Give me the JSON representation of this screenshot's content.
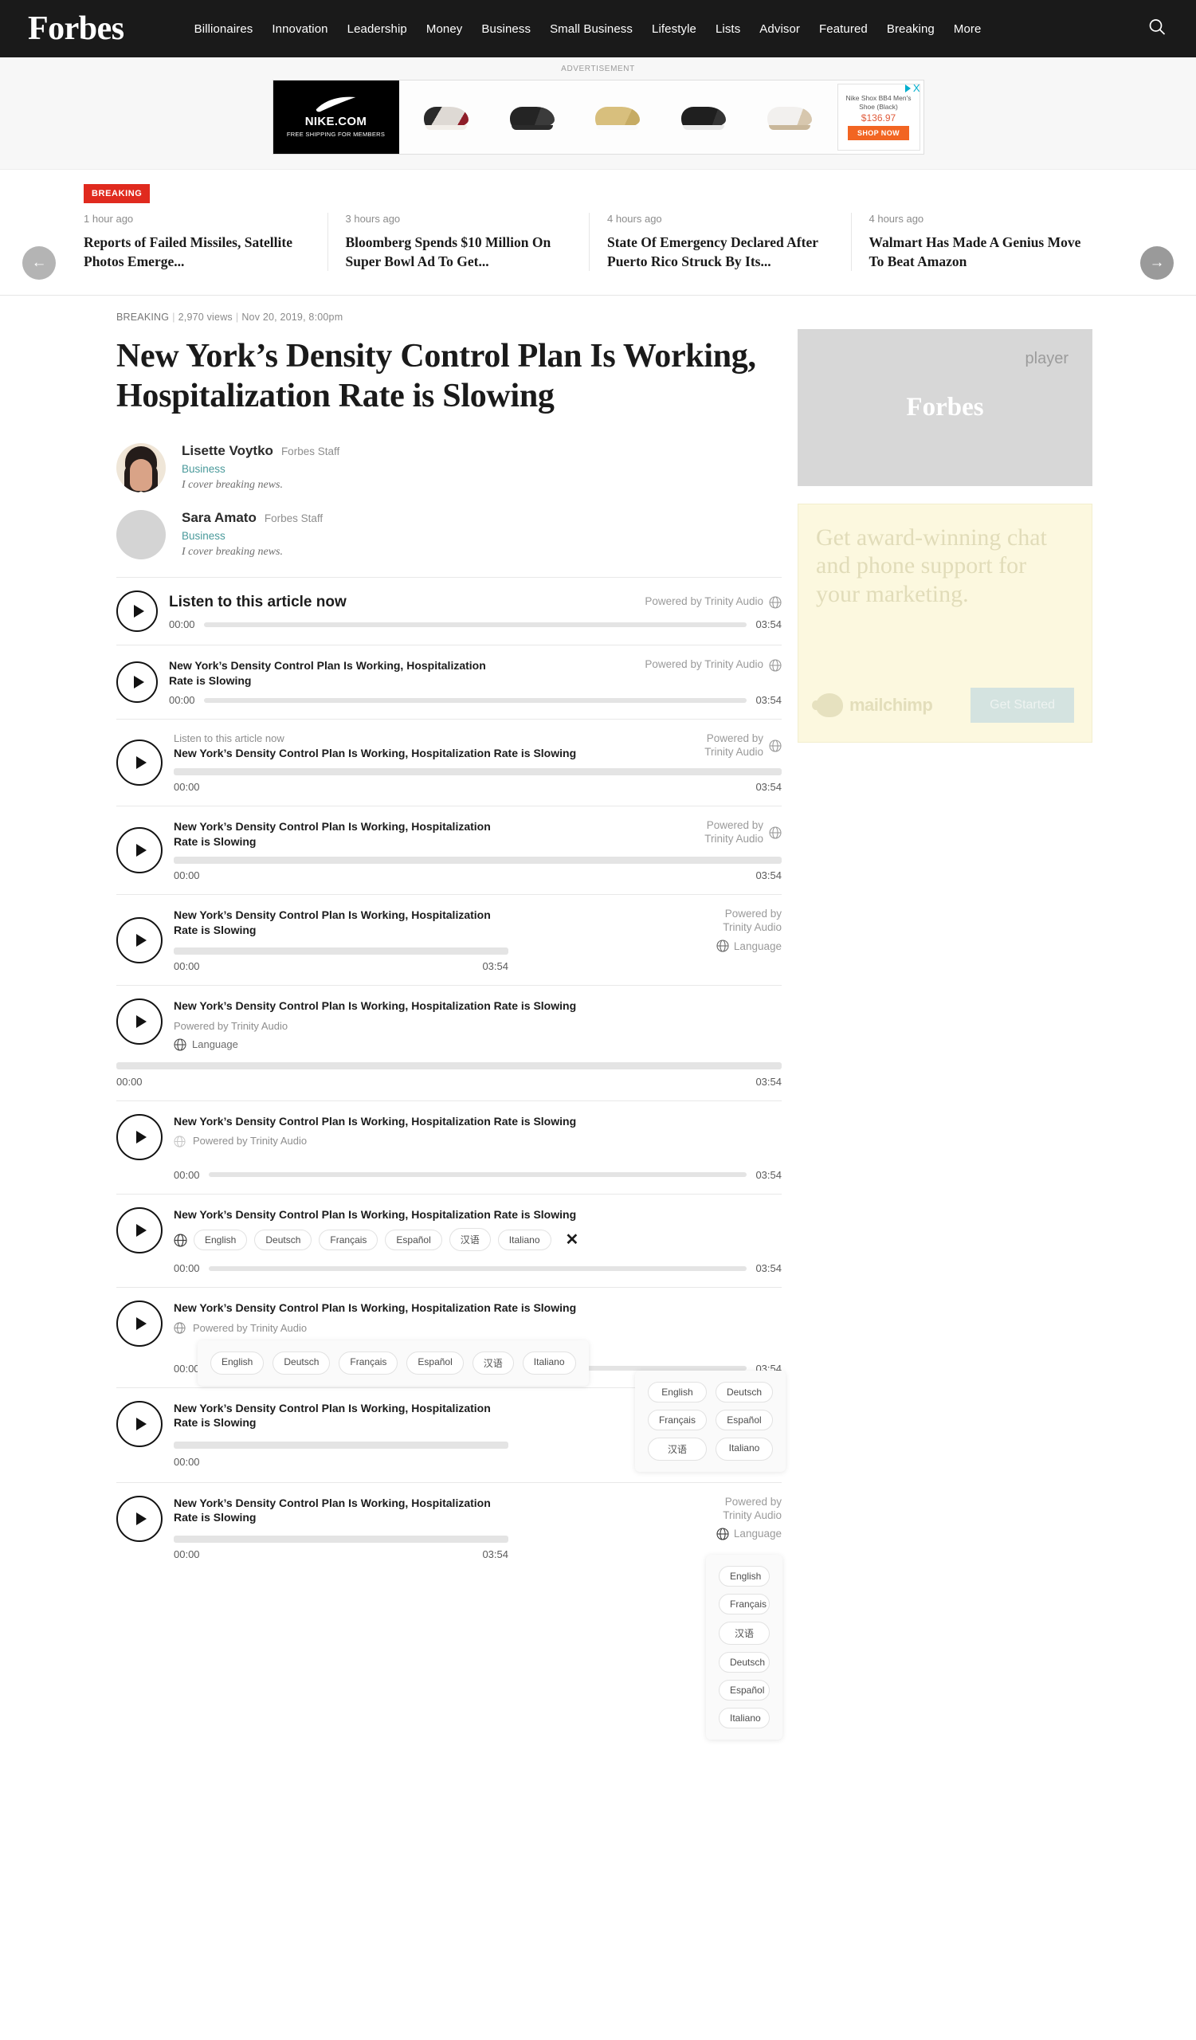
{
  "nav": {
    "logo": "Forbes",
    "items": [
      "Billionaires",
      "Innovation",
      "Leadership",
      "Money",
      "Business",
      "Small Business",
      "Lifestyle",
      "Lists",
      "Advisor",
      "Featured",
      "Breaking",
      "More"
    ],
    "search_icon": "search-icon"
  },
  "ad": {
    "label": "ADVERTISEMENT",
    "brand_url": "NIKE.COM",
    "brand_sub": "FREE SHIPPING FOR MEMBERS",
    "product_name": "Nike Shox BB4 Men's Shoe (Black)",
    "price": "$136.97",
    "cta": "SHOP NOW",
    "close": "X"
  },
  "breaking": {
    "badge": "BREAKING",
    "prev_arrow": "←",
    "next_arrow": "→",
    "items": [
      {
        "time": "1 hour ago",
        "title": "Reports of Failed Missiles, Satellite Photos Emerge..."
      },
      {
        "time": "3 hours ago",
        "title": "Bloomberg Spends $10 Million On Super Bowl Ad To Get..."
      },
      {
        "time": "4 hours ago",
        "title": "State Of Emergency Declared After Puerto Rico Struck By Its..."
      },
      {
        "time": "4 hours ago",
        "title": "Walmart Has Made A Genius Move To Beat Amazon"
      }
    ]
  },
  "article": {
    "category": "BREAKING",
    "views": "2,970 views",
    "date": "Nov 20, 2019, 8:00pm",
    "headline": "New York’s Density Control Plan Is Working, Hospitalization Rate is Slowing",
    "authors": [
      {
        "name": "Lisette Voytko",
        "role": "Forbes Staff",
        "category": "Business",
        "bio": "I cover breaking news."
      },
      {
        "name": "Sara Amato",
        "role": "Forbes Staff",
        "category": "Business",
        "bio": "I cover breaking news."
      }
    ]
  },
  "player": {
    "listen_label": "Listen to this article now",
    "title": "New York’s Density Control Plan Is Working, Hospitalization Rate is Slowing",
    "powered_by": "Powered by Trinity Audio",
    "powered_by_line1": "Powered by",
    "powered_by_line2": "Trinity Audio",
    "current_time": "00:00",
    "duration": "03:54",
    "language_label": "Language",
    "close_label": "✕",
    "globe_icon": "globe-icon",
    "play_icon": "play-icon",
    "languages": [
      "English",
      "Deutsch",
      "Français",
      "Español",
      "汉语",
      "Italiano"
    ],
    "languages_vertical": [
      "English",
      "Français",
      "汉语",
      "Deutsch",
      "Español",
      "Italiano"
    ]
  },
  "sidebar": {
    "player_badge": "player",
    "player_logo": "Forbes",
    "mailchimp_headline": "Get award-winning chat and phone support for your marketing.",
    "mailchimp_brand": "mailchimp",
    "mailchimp_cta": "Get Started"
  }
}
